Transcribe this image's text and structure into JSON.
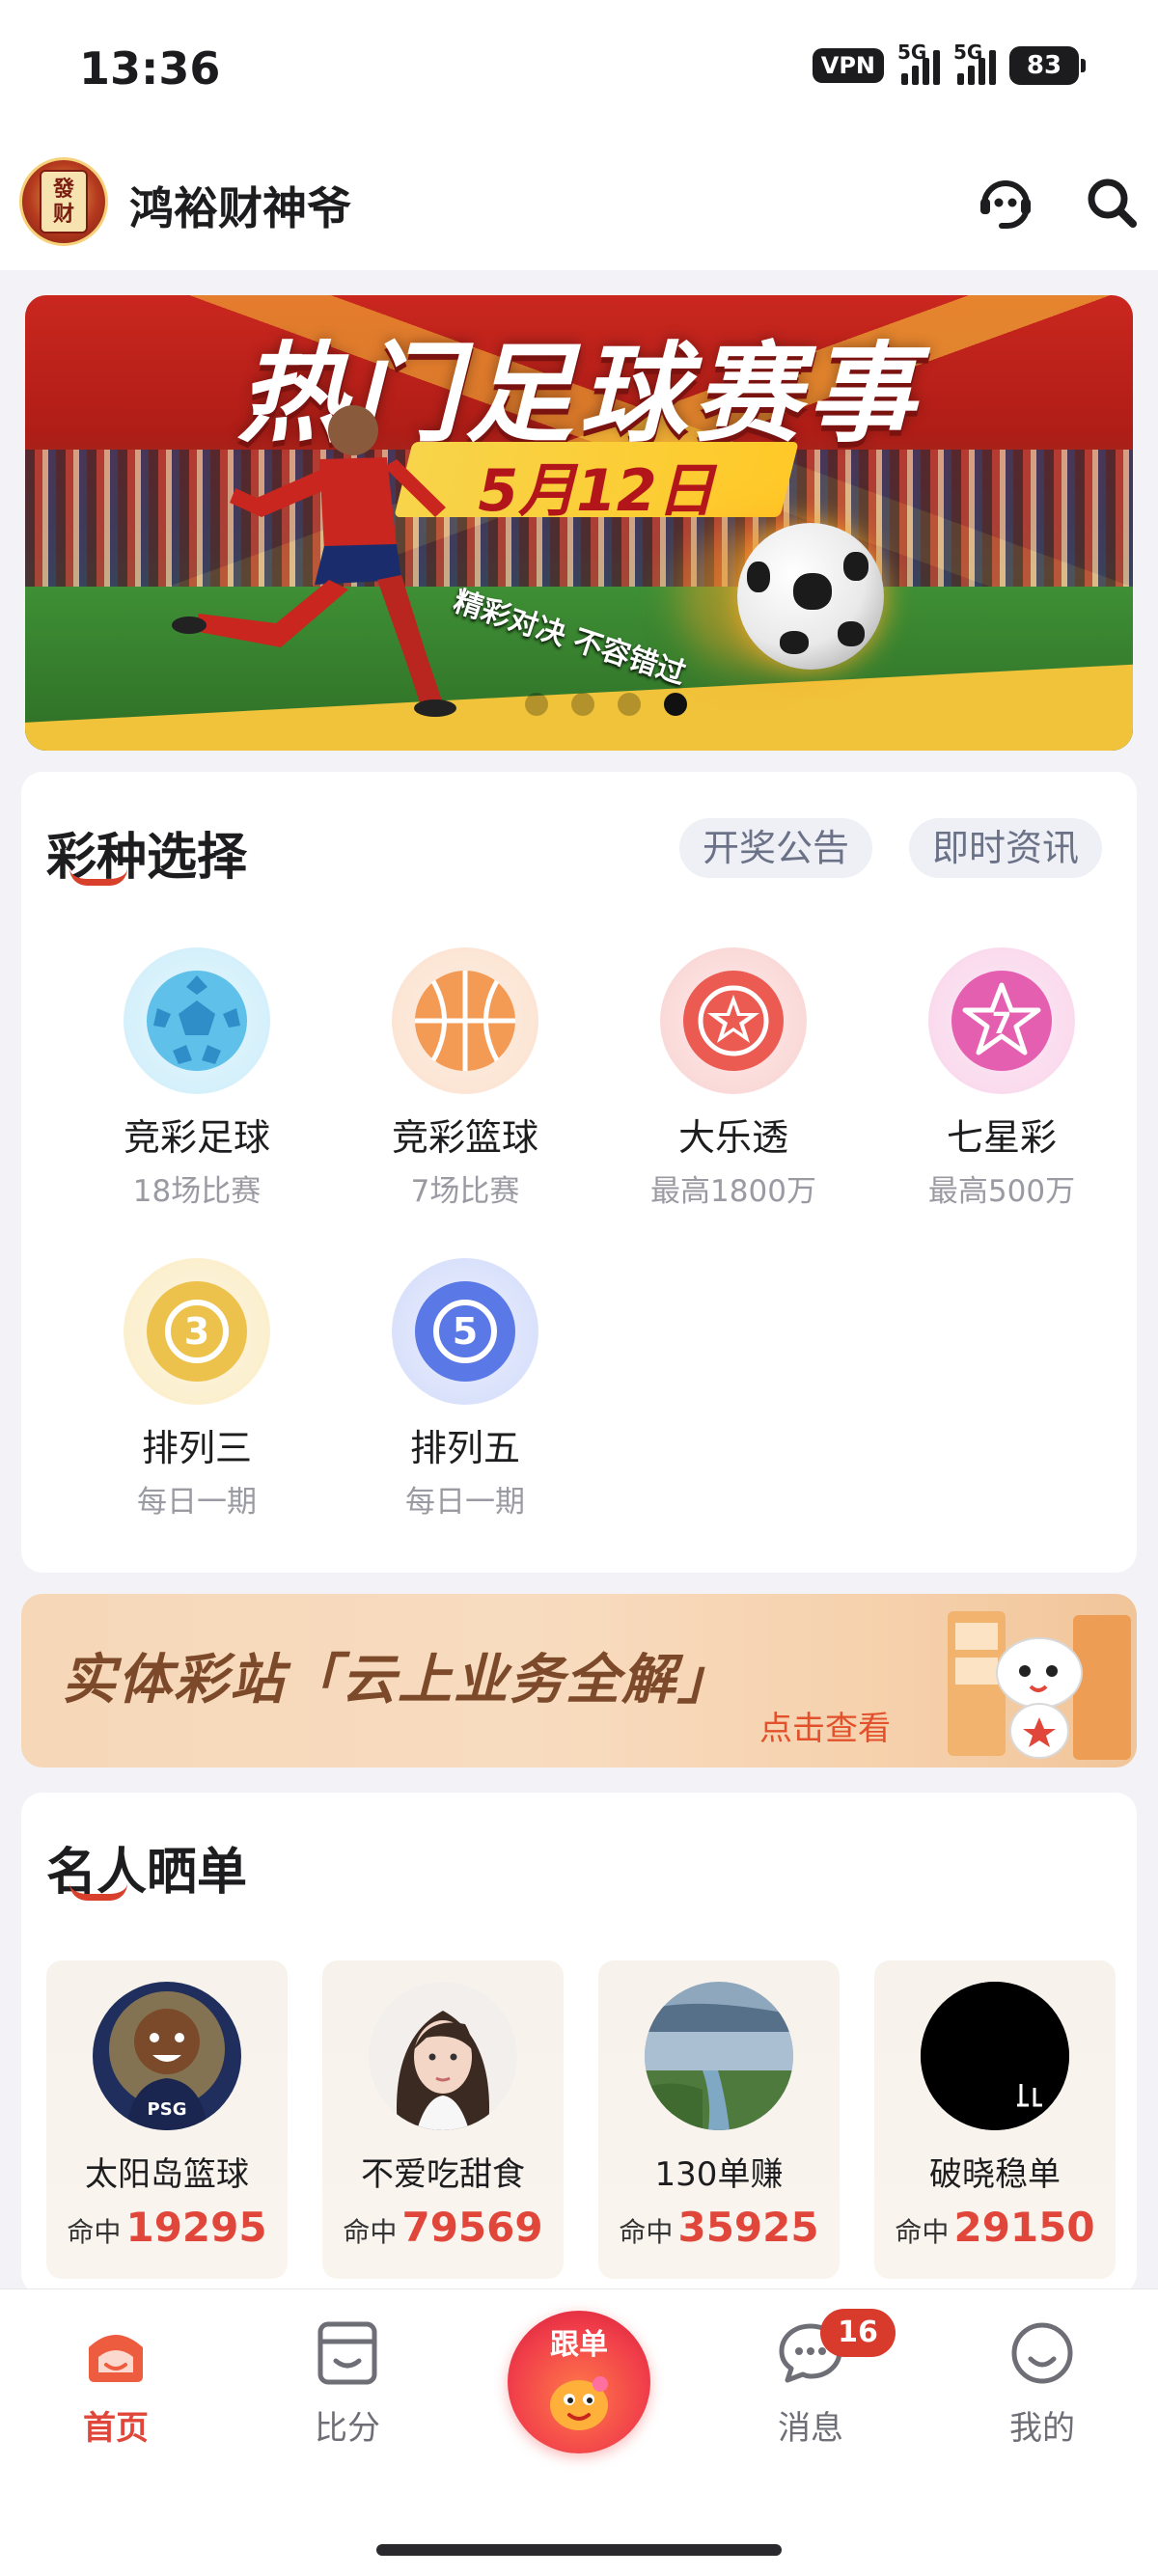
{
  "status_bar": {
    "time": "13:36",
    "vpn": "VPN",
    "signal1": "5G",
    "signal2": "5G",
    "battery": "83"
  },
  "header": {
    "app_name": "鸿裕财神爷",
    "avatar_text_1": "發",
    "avatar_text_2": "财"
  },
  "banner": {
    "title": "热门足球赛事",
    "date": "5月12日",
    "slogan": "精彩对决 不容错过",
    "dots": 4,
    "active_dot": 4
  },
  "lottery": {
    "title": "彩种选择",
    "links": {
      "notice": "开奖公告",
      "news": "即时资讯"
    },
    "items": [
      {
        "name": "竞彩足球",
        "sub": "18场比赛",
        "icon": "soccer-ball-icon",
        "color": "#62c3ea"
      },
      {
        "name": "竞彩篮球",
        "sub": "7场比赛",
        "icon": "basketball-icon",
        "color": "#f39a55"
      },
      {
        "name": "大乐透",
        "sub": "最高1800万",
        "icon": "star-ball-icon",
        "color": "#ec5b52"
      },
      {
        "name": "七星彩",
        "sub": "最高500万",
        "icon": "seven-star-icon",
        "color": "#e55fb0"
      },
      {
        "name": "排列三",
        "sub": "每日一期",
        "icon": "number-three-icon",
        "color": "#ecc24c"
      },
      {
        "name": "排列五",
        "sub": "每日一期",
        "icon": "number-five-icon",
        "color": "#5a78e6"
      }
    ]
  },
  "promo": {
    "title": "实体彩站「云上业务全解」",
    "link": "点击查看"
  },
  "celebrities": {
    "title": "名人晒单",
    "hit_label": "命中",
    "items": [
      {
        "name": "太阳岛篮球",
        "hits": "19295"
      },
      {
        "name": "不爱吃甜食",
        "hits": "79569"
      },
      {
        "name": "130单赚",
        "hits": "35925"
      },
      {
        "name": "破晓稳单",
        "hits": "29150"
      }
    ]
  },
  "bottom_nav": {
    "items": [
      {
        "label": "首页",
        "icon": "home-icon",
        "active": true
      },
      {
        "label": "比分",
        "icon": "score-icon",
        "active": false
      },
      {
        "label": "跟单",
        "icon": "follow-bet-icon",
        "active": false
      },
      {
        "label": "消息",
        "icon": "message-icon",
        "active": false,
        "badge": "16"
      },
      {
        "label": "我的",
        "icon": "profile-icon",
        "active": false
      }
    ]
  },
  "colors": {
    "accent": "#e0463a",
    "background": "#f3f3f7"
  }
}
